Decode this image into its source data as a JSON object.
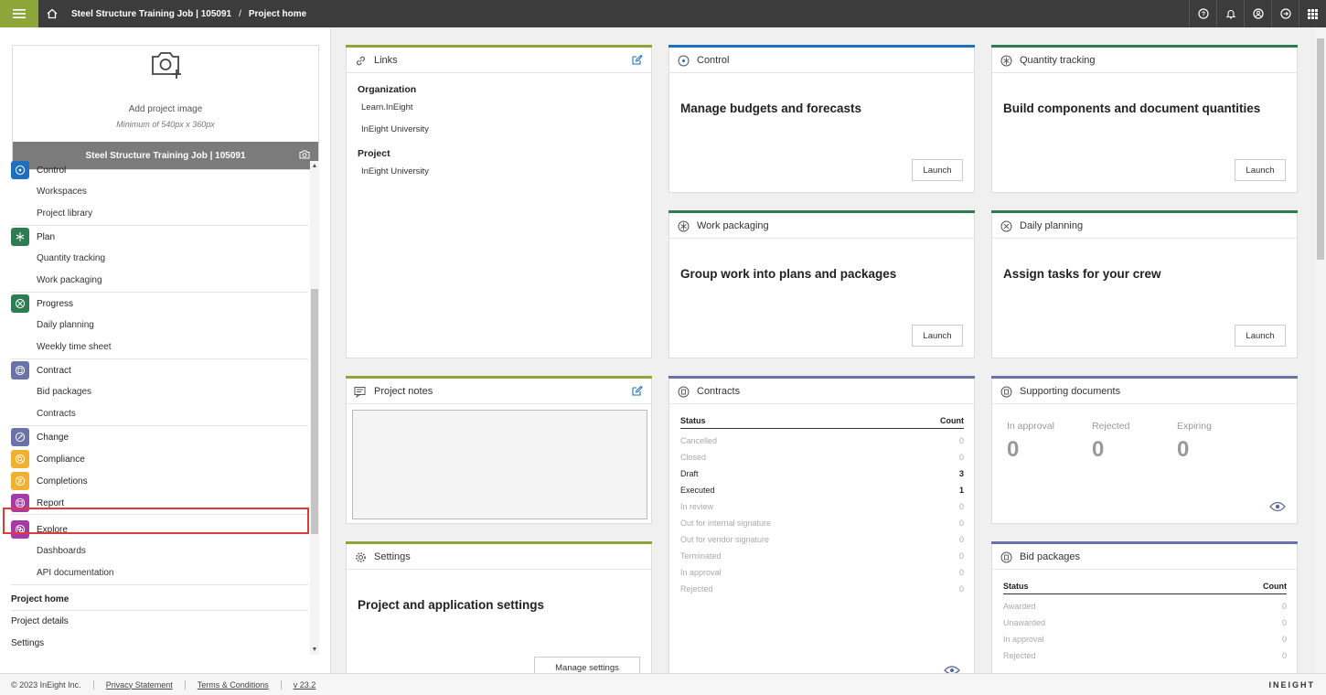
{
  "topbar": {
    "breadcrumb": [
      "Steel Structure Training Job | 105091",
      "Project home"
    ],
    "separator": "/"
  },
  "sidebar": {
    "add_image": "Add project image",
    "min_size": "Minimum of 540px x 360px",
    "project_name": "Steel Structure Training Job | 105091",
    "groups": [
      {
        "label": "Control",
        "color": "#1f6fc1",
        "subs": [
          "Workspaces",
          "Project library"
        ]
      },
      {
        "label": "Plan",
        "color": "#2e7d52",
        "subs": [
          "Quantity tracking",
          "Work packaging"
        ]
      },
      {
        "label": "Progress",
        "color": "#2e7d52",
        "subs": [
          "Daily planning",
          "Weekly time sheet"
        ]
      },
      {
        "label": "Contract",
        "color": "#6a72a8",
        "subs": [
          "Bid packages",
          "Contracts"
        ]
      }
    ],
    "singles": [
      {
        "label": "Change",
        "color": "#6a72a8"
      },
      {
        "label": "Compliance",
        "color": "#f1b12e"
      },
      {
        "label": "Completions",
        "color": "#f1b12e"
      },
      {
        "label": "Report",
        "color": "#a63ba8"
      }
    ],
    "explore": {
      "label": "Explore",
      "color": "#a63ba8",
      "subs": [
        "Dashboards",
        "API documentation"
      ]
    },
    "plain": [
      "Project home",
      "Project details",
      "Settings"
    ]
  },
  "cards": {
    "links": {
      "title": "Links",
      "org_label": "Organization",
      "org_links": [
        "Learn.InEight",
        "InEight University"
      ],
      "proj_label": "Project",
      "proj_links": [
        "InEight University"
      ]
    },
    "control": {
      "title": "Control",
      "headline": "Manage budgets and forecasts",
      "button": "Launch",
      "color": "#1f6fc1"
    },
    "quantity": {
      "title": "Quantity tracking",
      "headline": "Build components and document quantities",
      "button": "Launch",
      "color": "#2e7d52"
    },
    "workpack": {
      "title": "Work packaging",
      "headline": "Group work into plans and packages",
      "button": "Launch",
      "color": "#2e7d52"
    },
    "daily": {
      "title": "Daily planning",
      "headline": "Assign tasks for your crew",
      "button": "Launch",
      "color": "#2e7d52"
    },
    "notes": {
      "title": "Project notes"
    },
    "settings": {
      "title": "Settings",
      "headline": "Project and application settings",
      "button": "Manage settings"
    },
    "contracts": {
      "title": "Contracts",
      "col_status": "Status",
      "col_count": "Count",
      "rows": [
        {
          "status": "Cancelled",
          "count": "0"
        },
        {
          "status": "Closed",
          "count": "0"
        },
        {
          "status": "Draft",
          "count": "3"
        },
        {
          "status": "Executed",
          "count": "1"
        },
        {
          "status": "In review",
          "count": "0"
        },
        {
          "status": "Out for internal signature",
          "count": "0"
        },
        {
          "status": "Out for vendor signature",
          "count": "0"
        },
        {
          "status": "Terminated",
          "count": "0"
        },
        {
          "status": "In approval",
          "count": "0"
        },
        {
          "status": "Rejected",
          "count": "0"
        }
      ]
    },
    "docs": {
      "title": "Supporting documents",
      "stats": [
        {
          "label": "In approval",
          "value": "0"
        },
        {
          "label": "Rejected",
          "value": "0"
        },
        {
          "label": "Expiring",
          "value": "0"
        }
      ]
    },
    "bids": {
      "title": "Bid packages",
      "col_status": "Status",
      "col_count": "Count",
      "rows": [
        {
          "status": "Awarded",
          "count": "0"
        },
        {
          "status": "Unawarded",
          "count": "0"
        },
        {
          "status": "In approval",
          "count": "0"
        },
        {
          "status": "Rejected",
          "count": "0"
        }
      ]
    }
  },
  "footer": {
    "copyright": "© 2023 InEight Inc.",
    "privacy": "Privacy Statement",
    "terms": "Terms & Conditions",
    "version": "v 23.2",
    "brand": "INEIGHT"
  },
  "colors": {
    "green_accent": "#8ea53a",
    "blue_accent": "#1f6fc1",
    "dark_green": "#2e7d52",
    "purple_accent": "#6a72a8"
  }
}
